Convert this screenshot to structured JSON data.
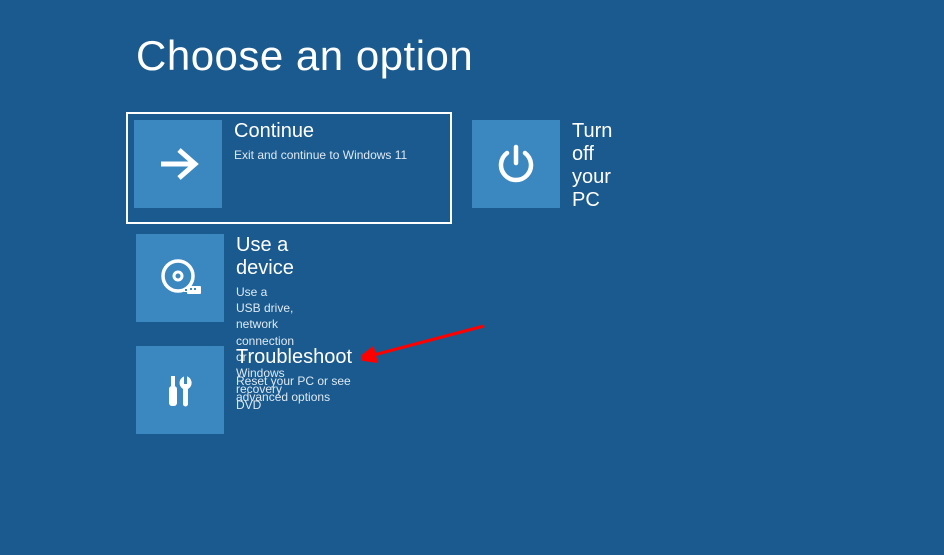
{
  "title": "Choose an option",
  "tiles": {
    "continue": {
      "title": "Continue",
      "desc": "Exit and continue to Windows 11",
      "icon": "arrow-right-icon"
    },
    "turnoff": {
      "title": "Turn off your PC",
      "desc": "",
      "icon": "power-icon"
    },
    "usedevice": {
      "title": "Use a device",
      "desc": "Use a USB drive, network connection or Windows recovery DVD",
      "icon": "disc-usb-icon"
    },
    "troubleshoot": {
      "title": "Troubleshoot",
      "desc": "Reset your PC or see advanced options",
      "icon": "tools-icon"
    }
  },
  "annotation": {
    "arrow_color": "#ff0000",
    "points_to": "troubleshoot"
  },
  "colors": {
    "background": "#1b5a8e",
    "tile_icon_bg": "#3a88bf",
    "text": "#ffffff"
  }
}
